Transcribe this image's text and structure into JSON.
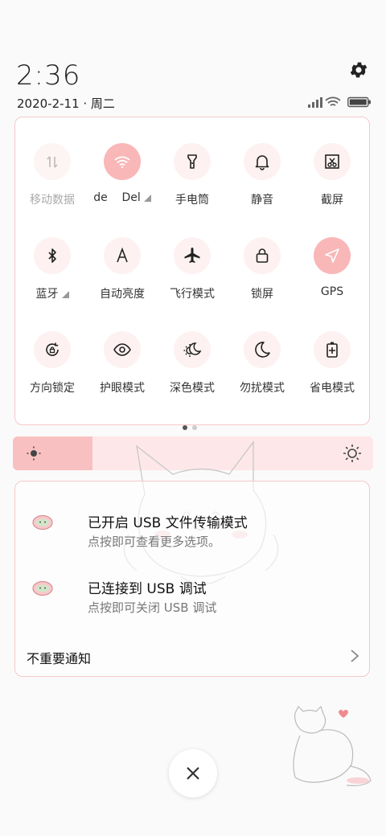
{
  "status": {
    "time": "2:36",
    "date": "2020-2-11 · 周二"
  },
  "colors": {
    "accent": "#f9b7b8",
    "border": "#f3c9cb",
    "bright_track": "#fde7e8",
    "bright_fill": "#f9c0c1"
  },
  "tiles": [
    {
      "label": "移动数据",
      "icon": "mobile-data-icon",
      "state": "disabled"
    },
    {
      "label": "de    Del",
      "icon": "wifi-icon",
      "state": "on",
      "has_menu": true
    },
    {
      "label": "手电筒",
      "icon": "flashlight-icon",
      "state": "off"
    },
    {
      "label": "静音",
      "icon": "bell-icon",
      "state": "off"
    },
    {
      "label": "截屏",
      "icon": "screenshot-icon",
      "state": "off"
    },
    {
      "label": "蓝牙",
      "icon": "bluetooth-icon",
      "state": "off",
      "has_menu": true
    },
    {
      "label": "自动亮度",
      "icon": "auto-brightness-icon",
      "state": "off"
    },
    {
      "label": "飞行模式",
      "icon": "airplane-icon",
      "state": "off"
    },
    {
      "label": "锁屏",
      "icon": "lock-icon",
      "state": "off"
    },
    {
      "label": "GPS",
      "icon": "gps-icon",
      "state": "on"
    },
    {
      "label": "方向锁定",
      "icon": "rotation-lock-icon",
      "state": "off"
    },
    {
      "label": "护眼模式",
      "icon": "eye-icon",
      "state": "off"
    },
    {
      "label": "深色模式",
      "icon": "dark-mode-icon",
      "state": "off"
    },
    {
      "label": "勿扰模式",
      "icon": "moon-icon",
      "state": "off"
    },
    {
      "label": "省电模式",
      "icon": "battery-saver-icon",
      "state": "off"
    }
  ],
  "pager": {
    "pages": 2,
    "current": 1
  },
  "brightness": {
    "level": 0.22
  },
  "notifications": [
    {
      "title": "已开启 USB 文件传输模式",
      "subtitle": "点按即可查看更多选项。",
      "icon": "usb-app-icon"
    },
    {
      "title": "已连接到 USB 调试",
      "subtitle": "点按即可关闭 USB 调试",
      "icon": "usb-app-icon"
    }
  ],
  "unimportant": {
    "label": "不重要通知"
  },
  "close": {
    "icon": "close-icon"
  }
}
